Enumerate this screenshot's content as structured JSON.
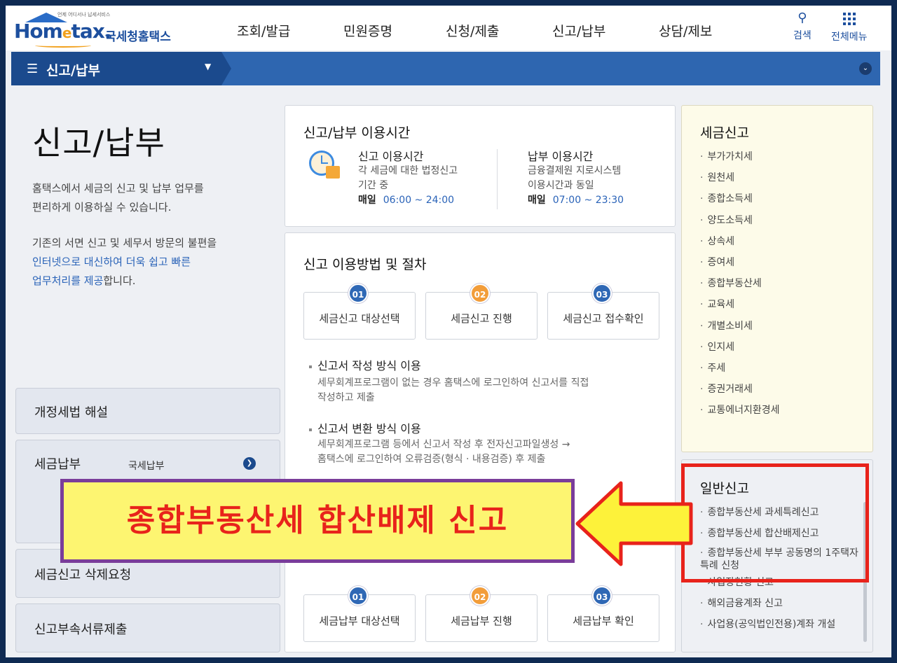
{
  "header": {
    "logo_word": "Hom",
    "logo_e": "e",
    "logo_word2": "tax.",
    "logo_sub": "국세청홈택스",
    "logo_tiny": "언제 어디서나 납세서비스",
    "nav": [
      "조회/발급",
      "민원증명",
      "신청/제출",
      "신고/납부",
      "상담/제보"
    ],
    "search_label": "검색",
    "allmenu_label": "전체메뉴"
  },
  "navbar": {
    "title": "신고/납부"
  },
  "intro": {
    "title": "신고/납부",
    "p1_line1": "홈택스에서 세금의 신고 및 납부 업무를",
    "p1_line2": "편리하게 이용하실 수 있습니다.",
    "p2_line1": "기존의 서면 신고 및 세무서 방문의 불편을",
    "p2_line2_hl": "인터넷으로 대신하여 더욱 쉽고 빠른",
    "p2_line3_hl": "업무처리를 제공",
    "p2_line3_rest": "합니다."
  },
  "left_menu": {
    "revision": "개정세법 해설",
    "payment": "세금납부",
    "payment_sub": "국세납부",
    "delete_request": "세금신고 삭제요청",
    "attach_docs": "신고부속서류제출"
  },
  "hours": {
    "title": "신고/납부 이용시간",
    "filing_head": "신고 이용시간",
    "filing_l1": "각 세금에 대한 법정신고",
    "filing_l2": "기간 중",
    "filing_day": "매일",
    "filing_time": "06:00 ~ 24:00",
    "pay_head": "납부 이용시간",
    "pay_l1": "금융결제원 지로시스템",
    "pay_l2": "이용시간과 동일",
    "pay_day": "매일",
    "pay_time": "07:00 ~ 23:30"
  },
  "procedure": {
    "title": "신고 이용방법 및 절차",
    "steps": [
      {
        "num": "01",
        "label": "세금신고 대상선택"
      },
      {
        "num": "02",
        "label": "세금신고 진행"
      },
      {
        "num": "03",
        "label": "세금신고 접수확인"
      }
    ],
    "opt1_title": "신고서 작성 방식 이용",
    "opt1_l1": "세무회계프로그램이 없는 경우 홈택스에 로그인하여 신고서를 직접",
    "opt1_l2": "작성하고 제출",
    "opt2_title": "신고서 변환 방식 이용",
    "opt2_l1": "세무회계프로그램 등에서 신고서 작성 후 전자신고파일생성 →",
    "opt2_l2": "홈택스에 로그인하여 오류검증(형식 · 내용검증) 후 제출",
    "pay_steps": [
      {
        "num": "01",
        "label": "세금납부 대상선택"
      },
      {
        "num": "02",
        "label": "세금납부 진행"
      },
      {
        "num": "03",
        "label": "세금납부 확인"
      }
    ]
  },
  "tax_filing": {
    "title": "세금신고",
    "items": [
      "부가가치세",
      "원천세",
      "종합소득세",
      "양도소득세",
      "상속세",
      "증여세",
      "종합부동산세",
      "교육세",
      "개별소비세",
      "인지세",
      "주세",
      "증권거래세",
      "교통에너지환경세"
    ]
  },
  "general_filing": {
    "title": "일반신고",
    "items": [
      "종합부동산세 과세특례신고",
      "종합부동산세 합산배제신고",
      "종합부동산세 부부 공동명의 1주택자 특례 신청",
      "사업장현황 신고",
      "해외금융계좌 신고",
      "사업용(공익법인전용)계좌 개설"
    ]
  },
  "callout": {
    "text": "종합부동산세 합산배제 신고"
  },
  "colors": {
    "primary": "#1b4a8d",
    "accent_red": "#e8231b",
    "banner_yellow": "#fdf571",
    "banner_purple": "#7a3d9a"
  }
}
